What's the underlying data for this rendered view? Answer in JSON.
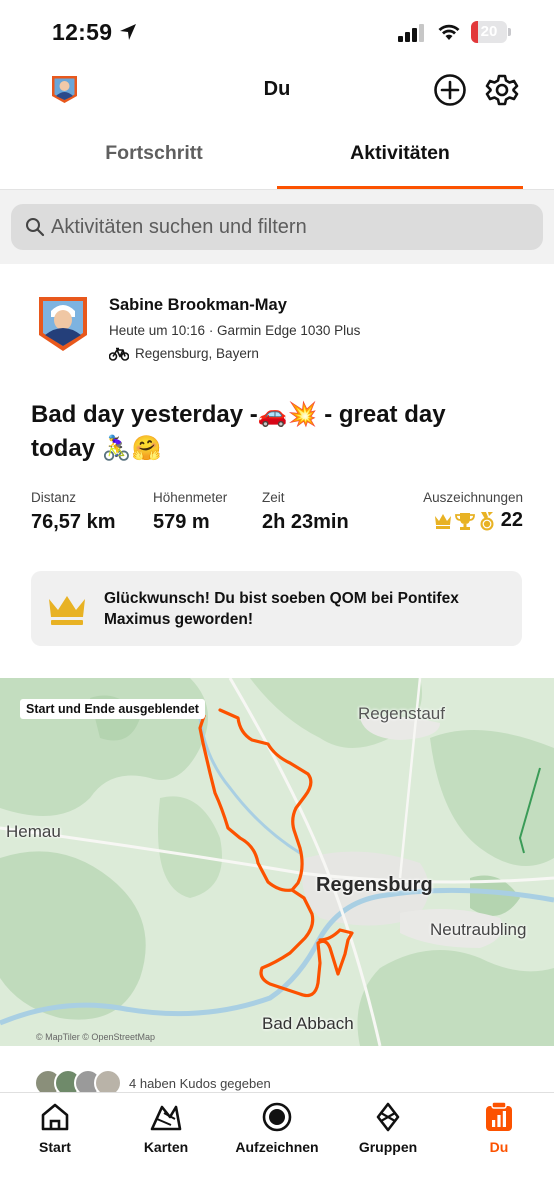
{
  "status_bar": {
    "time": "12:59",
    "battery": "20",
    "battery_level": 0.2
  },
  "header": {
    "title": "Du",
    "add_icon": "plus-circle-icon",
    "settings_icon": "gear-icon"
  },
  "tabs": [
    {
      "label": "Fortschritt",
      "active": false
    },
    {
      "label": "Aktivitäten",
      "active": true
    }
  ],
  "search": {
    "placeholder": "Aktivitäten suchen und filtern"
  },
  "activity": {
    "athlete_name": "Sabine Brookman-May",
    "meta": "Heute um 10:16 · Garmin Edge 1030 Plus",
    "location": "Regensburg, Bayern",
    "title": "Bad day yesterday -🚗💥 - great day today 🚴‍♀️🤗",
    "stats": {
      "distance_label": "Distanz",
      "distance_value": "76,57 km",
      "elevation_label": "Höhenmeter",
      "elevation_value": "579 m",
      "time_label": "Zeit",
      "time_value": "2h 23min",
      "awards_label": "Auszeichnungen",
      "awards_count": "22"
    },
    "banner": "Glückwunsch! Du bist soeben QOM bei Pontifex Maximus geworden!",
    "map": {
      "chip": "Start und Ende ausgeblendet",
      "places": [
        "Regenstauf",
        "Hemau",
        "Regensburg",
        "Neutraubling",
        "Bad Abbach"
      ],
      "attribution": "© MapTiler © OpenStreetMap",
      "route_color": "#fc5200"
    },
    "kudos": "4 haben Kudos gegeben"
  },
  "bottom_nav": [
    {
      "label": "Start",
      "icon": "home-icon",
      "active": false
    },
    {
      "label": "Karten",
      "icon": "map-icon",
      "active": false
    },
    {
      "label": "Aufzeichnen",
      "icon": "record-icon",
      "active": false
    },
    {
      "label": "Gruppen",
      "icon": "groups-icon",
      "active": false
    },
    {
      "label": "Du",
      "icon": "profile-chart-icon",
      "active": true
    }
  ],
  "colors": {
    "accent": "#fc5200",
    "gold": "#e8b224"
  }
}
